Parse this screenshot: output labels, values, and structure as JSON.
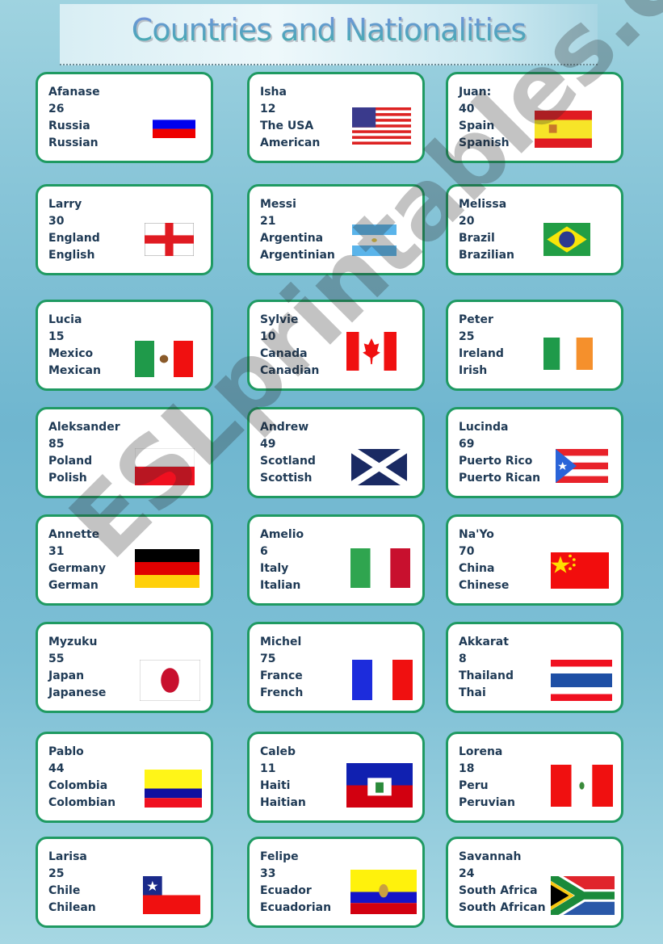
{
  "title": "Countries and Nationalities",
  "watermark": "ESLprintables.com",
  "cards": [
    {
      "name": "Afanase",
      "age": "26",
      "country": "Russia",
      "nationality": "Russian",
      "flag_icon": "russia-flag-icon"
    },
    {
      "name": "Isha",
      "age": "12",
      "country": "The USA",
      "nationality": "American",
      "flag_icon": "usa-flag-icon"
    },
    {
      "name": "Juan:",
      "age": "40",
      "country": "Spain",
      "nationality": "Spanish",
      "flag_icon": "spain-flag-icon"
    },
    {
      "name": "Larry",
      "age": "30",
      "country": "England",
      "nationality": "English",
      "flag_icon": "england-flag-icon"
    },
    {
      "name": "Messi",
      "age": "21",
      "country": "Argentina",
      "nationality": "Argentinian",
      "flag_icon": "argentina-flag-icon"
    },
    {
      "name": "Melissa",
      "age": "20",
      "country": "Brazil",
      "nationality": "Brazilian",
      "flag_icon": "brazil-flag-icon"
    },
    {
      "name": "Lucia",
      "age": "15",
      "country": "Mexico",
      "nationality": "Mexican",
      "flag_icon": "mexico-flag-icon"
    },
    {
      "name": "Sylvie",
      "age": "10",
      "country": "Canada",
      "nationality": "Canadian",
      "flag_icon": "canada-flag-icon"
    },
    {
      "name": "Peter",
      "age": "25",
      "country": "Ireland",
      "nationality": "Irish",
      "flag_icon": "ireland-flag-icon"
    },
    {
      "name": "Aleksander",
      "age": "85",
      "country": "Poland",
      "nationality": "Polish",
      "flag_icon": "poland-flag-icon"
    },
    {
      "name": "Andrew",
      "age": "49",
      "country": "Scotland",
      "nationality": "Scottish",
      "flag_icon": "scotland-flag-icon"
    },
    {
      "name": "Lucinda",
      "age": "69",
      "country": "Puerto Rico",
      "nationality": "Puerto Rican",
      "flag_icon": "puerto-rico-flag-icon"
    },
    {
      "name": "Annette",
      "age": "31",
      "country": "Germany",
      "nationality": "German",
      "flag_icon": "germany-flag-icon"
    },
    {
      "name": "Amelio",
      "age": "6",
      "country": "Italy",
      "nationality": "Italian",
      "flag_icon": "italy-flag-icon"
    },
    {
      "name": "Na'Yo",
      "age": "70",
      "country": "China",
      "nationality": "Chinese",
      "flag_icon": "china-flag-icon"
    },
    {
      "name": "Myzuku",
      "age": "55",
      "country": "Japan",
      "nationality": "Japanese",
      "flag_icon": "japan-flag-icon"
    },
    {
      "name": "Michel",
      "age": "75",
      "country": "France",
      "nationality": "French",
      "flag_icon": "france-flag-icon"
    },
    {
      "name": "Akkarat",
      "age": "8",
      "country": "Thailand",
      "nationality": "Thai",
      "flag_icon": "thailand-flag-icon"
    },
    {
      "name": "Pablo",
      "age": "44",
      "country": "Colombia",
      "nationality": "Colombian",
      "flag_icon": "colombia-flag-icon"
    },
    {
      "name": "Caleb",
      "age": "11",
      "country": "Haiti",
      "nationality": "Haitian",
      "flag_icon": "haiti-flag-icon"
    },
    {
      "name": "Lorena",
      "age": "18",
      "country": "Peru",
      "nationality": "Peruvian",
      "flag_icon": "peru-flag-icon"
    },
    {
      "name": "Larisa",
      "age": "25",
      "country": "Chile",
      "nationality": "Chilean",
      "flag_icon": "chile-flag-icon"
    },
    {
      "name": "Felipe",
      "age": "33",
      "country": "Ecuador",
      "nationality": "Ecuadorian",
      "flag_icon": "ecuador-flag-icon"
    },
    {
      "name": "Savannah",
      "age": "24",
      "country": "South Africa",
      "nationality": "South African",
      "flag_icon": "south-africa-flag-icon"
    }
  ],
  "colors": {
    "card_border": "#1f9a62",
    "text": "#1f3a55"
  }
}
